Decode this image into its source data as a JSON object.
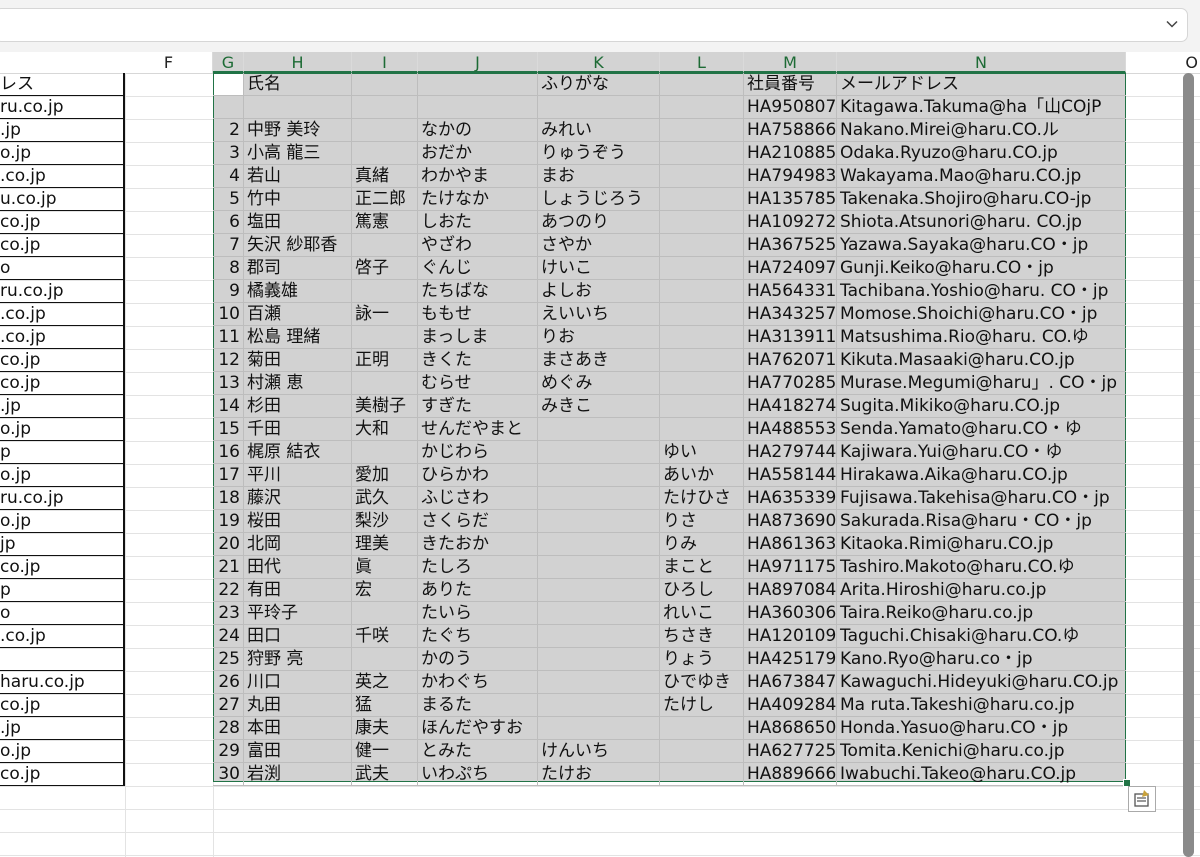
{
  "formula_bar": {
    "value": "",
    "dropdown_icon": "chevron-down-icon"
  },
  "columns": [
    "F",
    "G",
    "H",
    "I",
    "J",
    "K",
    "L",
    "M",
    "N",
    "O"
  ],
  "left_table": {
    "header": "レス",
    "cells": [
      "ru.co.jp",
      ".jp",
      "o.jp",
      ".co.jp",
      "u.co.jp",
      "co.jp",
      "co.jp",
      "o",
      "ru.co.jp",
      ".co.jp",
      ".co.jp",
      "co.jp",
      "co.jp",
      ".jp",
      "o.jp",
      "p",
      "o.jp",
      "ru.co.jp",
      "o.jp",
      "jp",
      "co.jp",
      "p",
      "o",
      ".co.jp",
      "",
      "haru.co.jp",
      "co.jp",
      ".jp",
      "o.jp",
      "co.jp"
    ]
  },
  "selection": {
    "header_row": {
      "g": "",
      "h": "氏名",
      "i": "",
      "j": "",
      "k": "ふりがな",
      "l": "",
      "m": "社員番号",
      "n": "メールアドレス"
    },
    "rows": [
      {
        "g": "",
        "h": "",
        "i": "",
        "j": "",
        "k": "",
        "l": "",
        "m": "HA950807",
        "n": "Kitagawa.Takuma@ha「山COjP"
      },
      {
        "g": "2",
        "h": "中野 美玲",
        "i": "",
        "j": "なかの",
        "k": "みれい",
        "l": "",
        "m": "HA758866",
        "n": "Nakano.Mirei@haru.CO.ル"
      },
      {
        "g": "3",
        "h": "小高 龍三",
        "i": "",
        "j": "おだか",
        "k": "りゅうぞう",
        "l": "",
        "m": "HA210885",
        "n": "Odaka.Ryuzo@haru.CO.jp"
      },
      {
        "g": "4",
        "h": "若山",
        "i": "真緒",
        "j": "わかやま",
        "k": "まお",
        "l": "",
        "m": "HA794983",
        "n": "Wakayama.Mao@haru.CO.jp"
      },
      {
        "g": "5",
        "h": "竹中",
        "i": "正二郎",
        "j": "たけなか",
        "k": "しょうじろう",
        "l": "",
        "m": "HA135785",
        "n": "Takenaka.Shojiro@haru.CO-jp"
      },
      {
        "g": "6",
        "h": "塩田",
        "i": "篤憲",
        "j": "しおた",
        "k": "あつのり",
        "l": "",
        "m": "HA109272",
        "n": "Shiota.Atsunori@haru. CO.jp"
      },
      {
        "g": "7",
        "h": "矢沢 紗耶香",
        "i": "",
        "j": "やざわ",
        "k": "さやか",
        "l": "",
        "m": "HA367525",
        "n": "Yazawa.Sayaka@haru.CO・jp"
      },
      {
        "g": "8",
        "h": "郡司",
        "i": "啓子",
        "j": "ぐんじ",
        "k": "けいこ",
        "l": "",
        "m": "HA724097",
        "n": "Gunji.Keiko@haru.CO・jp"
      },
      {
        "g": "9",
        "h": "橘義雄",
        "i": "",
        "j": "たちばな",
        "k": "よしお",
        "l": "",
        "m": "HA564331",
        "n": "Tachibana.Yoshio@haru. CO・jp"
      },
      {
        "g": "10",
        "h": "百瀬",
        "i": "詠一",
        "j": "ももせ",
        "k": "えいいち",
        "l": "",
        "m": "HA343257",
        "n": "Momose.Shoichi@haru.CO・jp"
      },
      {
        "g": "11",
        "h": "松島 理緒",
        "i": "",
        "j": "まっしま",
        "k": "りお",
        "l": "",
        "m": "HA313911",
        "n": "Matsushima.Rio@haru. CO.ゆ"
      },
      {
        "g": "12",
        "h": "菊田",
        "i": "正明",
        "j": "きくた",
        "k": "まさあき",
        "l": "",
        "m": "HA762071",
        "n": "Kikuta.Masaaki@haru.CO.jp"
      },
      {
        "g": "13",
        "h": "村瀬 恵",
        "i": "",
        "j": "むらせ",
        "k": "めぐみ",
        "l": "",
        "m": "HA770285",
        "n": "Murase.Megumi@haru」. CO・jp"
      },
      {
        "g": "14",
        "h": "杉田",
        "i": "美樹子",
        "j": "すぎた",
        "k": "みきこ",
        "l": "",
        "m": "HA418274",
        "n": "Sugita.Mikiko@haru.CO.jp"
      },
      {
        "g": "15",
        "h": "千田",
        "i": "大和",
        "j": "せんだやまと",
        "k": "",
        "l": "",
        "m": "HA488553",
        "n": "Senda.Yamato@haru.CO・ゆ"
      },
      {
        "g": "16",
        "h": "梶原 結衣",
        "i": "",
        "j": "かじわら",
        "k": "",
        "l": "ゆい",
        "m": "HA279744",
        "n": "Kajiwara.Yui@haru.CO・ゆ"
      },
      {
        "g": "17",
        "h": "平川",
        "i": "愛加",
        "j": "ひらかわ",
        "k": "",
        "l": "あいか",
        "m": "HA558144",
        "n": "Hirakawa.Aika@haru.CO.jp"
      },
      {
        "g": "18",
        "h": "藤沢",
        "i": "武久",
        "j": "ふじさわ",
        "k": "",
        "l": "たけひさ",
        "m": "HA635339",
        "n": "Fujisawa.Takehisa@haru.CO・jp"
      },
      {
        "g": "19",
        "h": "桜田",
        "i": "梨沙",
        "j": "さくらだ",
        "k": "",
        "l": "りさ",
        "m": "HA873690",
        "n": "Sakurada.Risa@haru・CO・jp"
      },
      {
        "g": "20",
        "h": "北岡",
        "i": "理美",
        "j": "きたおか",
        "k": "",
        "l": "りみ",
        "m": "HA861363",
        "n": "Kitaoka.Rimi@haru.CO.jp"
      },
      {
        "g": "21",
        "h": "田代",
        "i": "眞",
        "j": "たしろ",
        "k": "",
        "l": "まこと",
        "m": "HA971175",
        "n": "Tashiro.Makoto@haru.CO.ゆ"
      },
      {
        "g": "22",
        "h": "有田",
        "i": "宏",
        "j": "ありた",
        "k": "",
        "l": "ひろし",
        "m": "HA897084",
        "n": "Arita.Hiroshi@haru.co.jp"
      },
      {
        "g": "23",
        "h": "平玲子",
        "i": "",
        "j": "たいら",
        "k": "",
        "l": "れいこ",
        "m": "HA360306",
        "n": "Taira.Reiko@haru.co.jp"
      },
      {
        "g": "24",
        "h": "田口",
        "i": "千咲",
        "j": "たぐち",
        "k": "",
        "l": "ちさき",
        "m": "HA120109",
        "n": "Taguchi.Chisaki@haru.CO.ゆ"
      },
      {
        "g": "25",
        "h": "狩野 亮",
        "i": "",
        "j": "かのう",
        "k": "",
        "l": "りょう",
        "m": "HA425179",
        "n": "Kano.Ryo@haru.co・jp"
      },
      {
        "g": "26",
        "h": "川口",
        "i": "英之",
        "j": "かわぐち",
        "k": "",
        "l": "ひでゆき",
        "m": "HA673847",
        "n": "Kawaguchi.Hideyuki@haru.CO.jp"
      },
      {
        "g": "27",
        "h": "丸田",
        "i": "猛",
        "j": "まるた",
        "k": "",
        "l": "たけし",
        "m": "HA409284",
        "n": "Ma ruta.Takeshi@haru.co.jp"
      },
      {
        "g": "28",
        "h": "本田",
        "i": "康夫",
        "j": "ほんだやすお",
        "k": "",
        "l": "",
        "m": "HA868650",
        "n": "Honda.Yasuo@haru.CO・jp"
      },
      {
        "g": "29",
        "h": "富田",
        "i": "健一",
        "j": "とみた",
        "k": "けんいち",
        "l": "",
        "m": "HA627725",
        "n": "Tomita.Kenichi@haru.co.jp"
      },
      {
        "g": "30",
        "h": "岩渕",
        "i": "武夫",
        "j": "いわぷち",
        "k": "たけお",
        "l": "",
        "m": "HA889666",
        "n": "Iwabuchi.Takeo@haru.CO.jp"
      }
    ]
  },
  "quick_analysis_icon": "quick-analysis-icon",
  "colors": {
    "selection_border": "#217346",
    "selection_fill": "#d2d2d2",
    "selected_header_text": "#1d6b35"
  }
}
